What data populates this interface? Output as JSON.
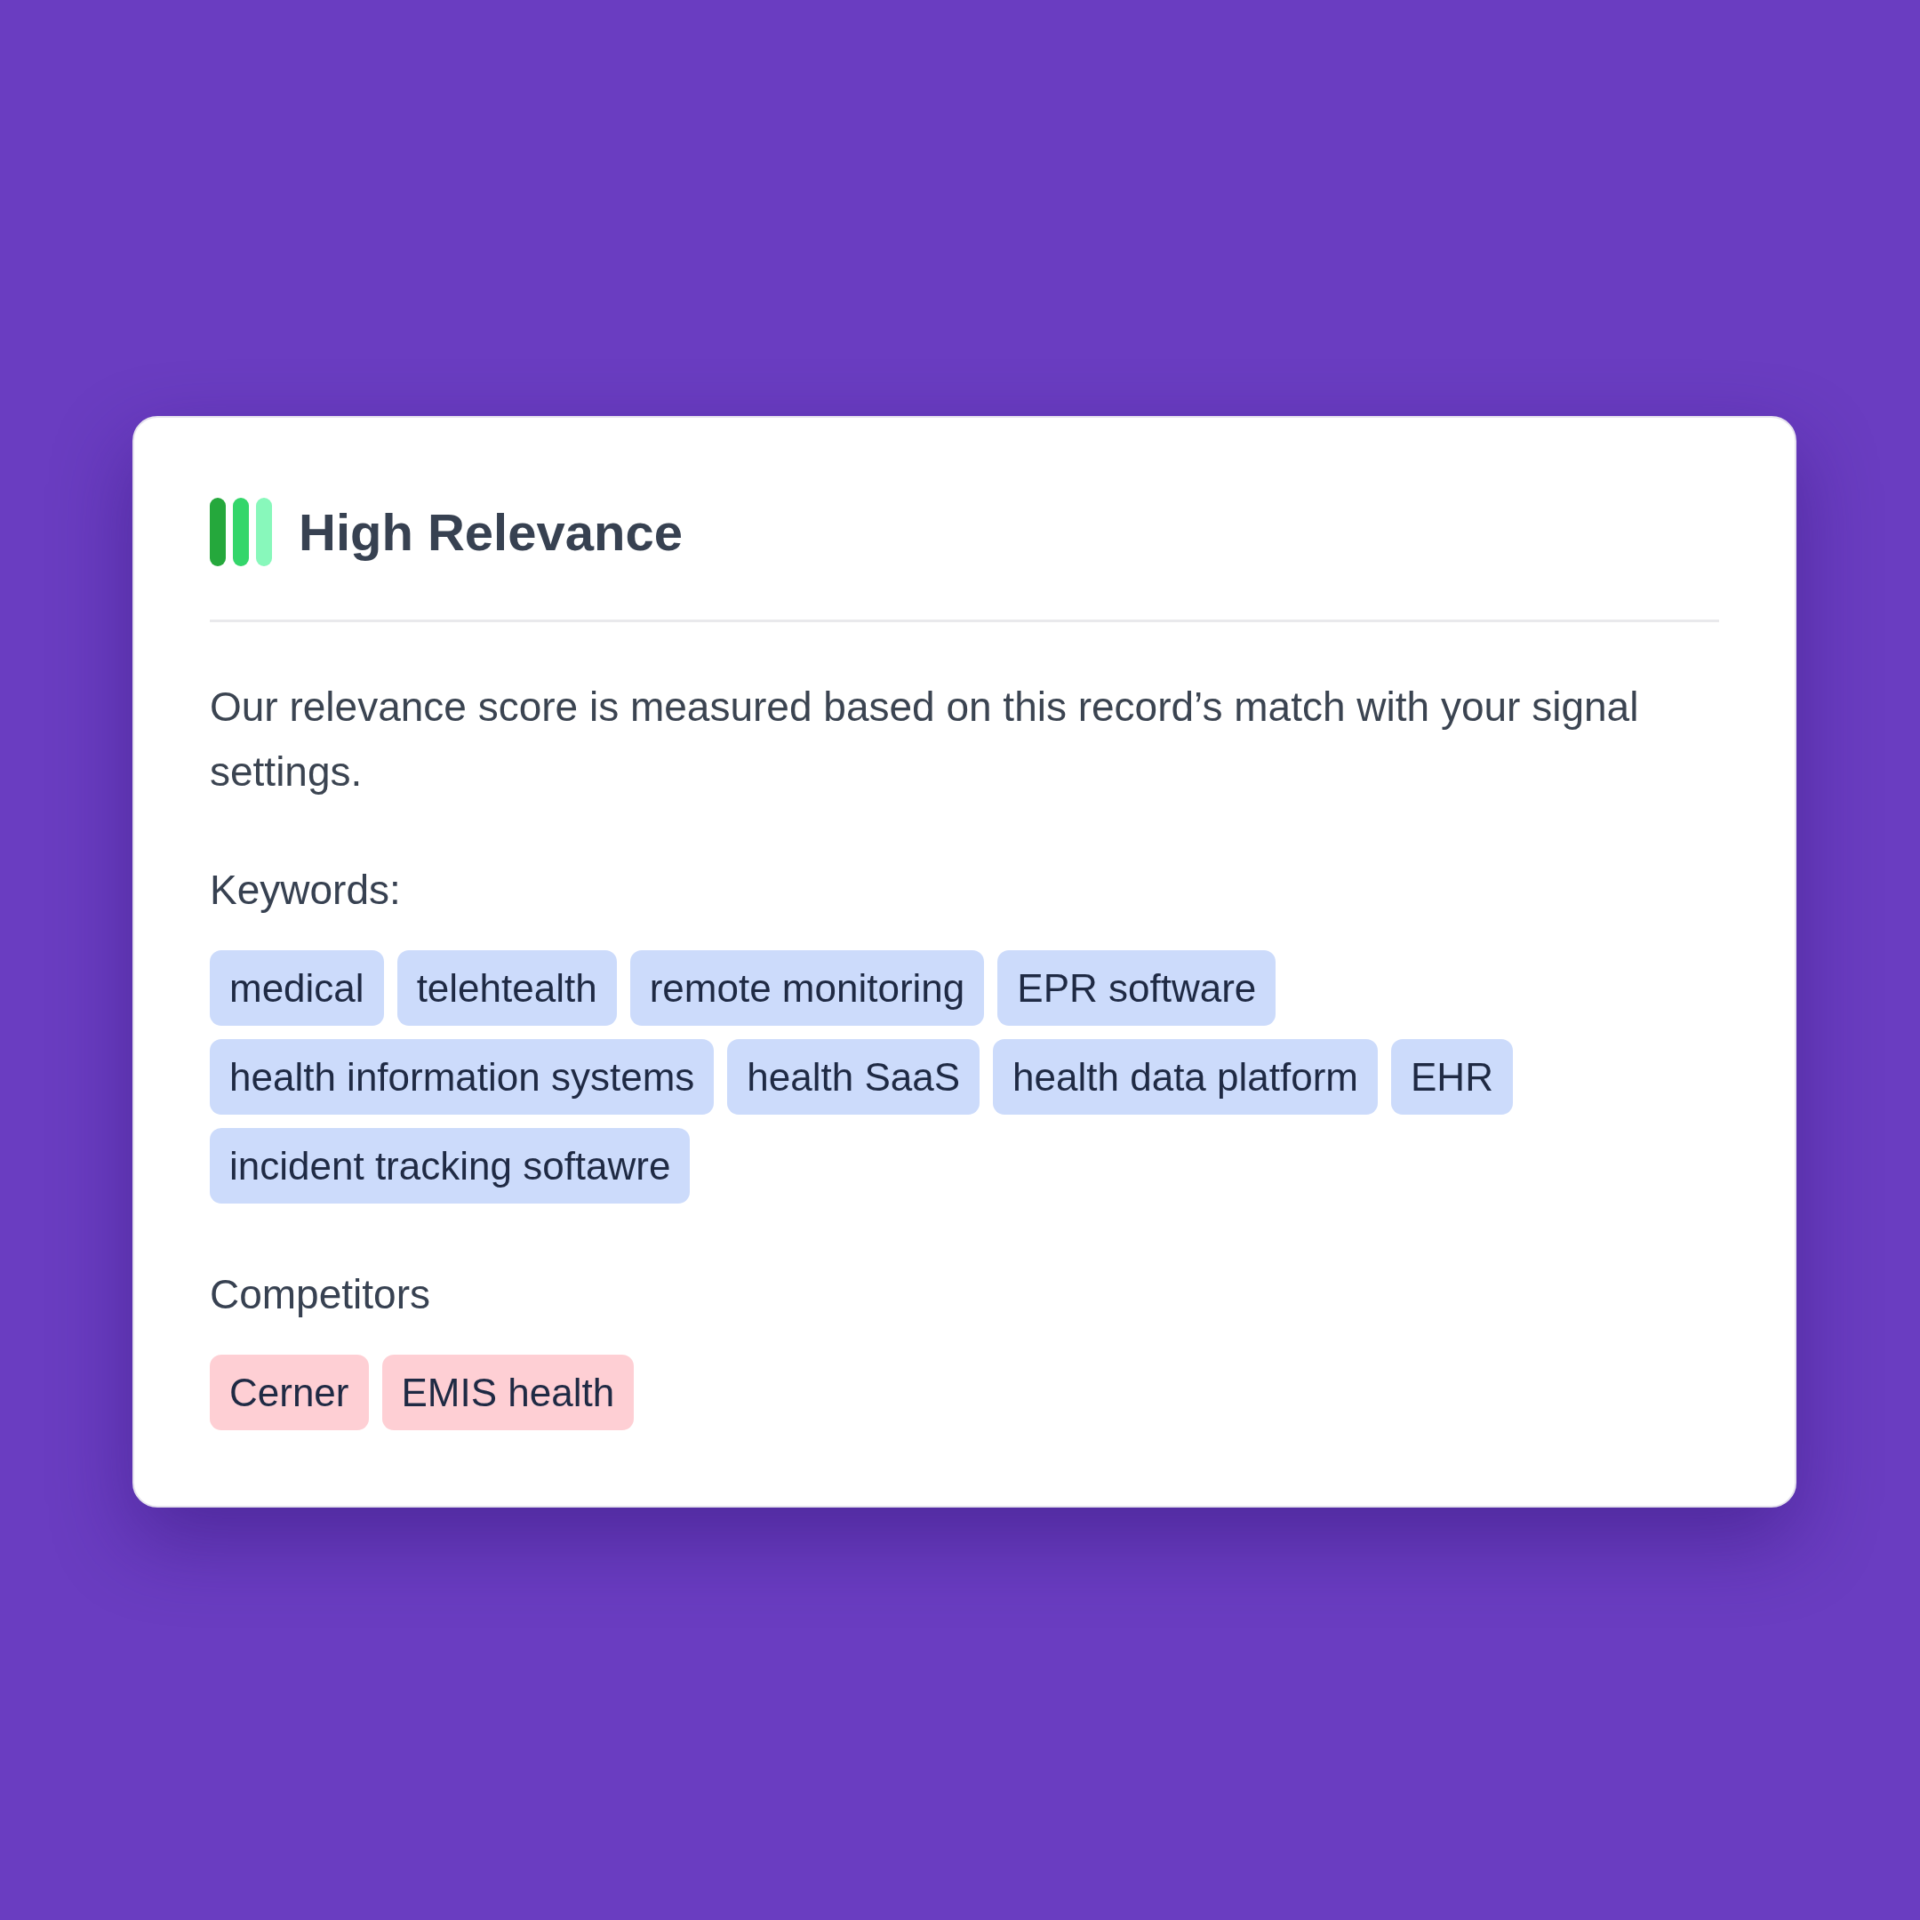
{
  "card": {
    "title": "High Relevance",
    "description": "Our relevance score is measured based on this record’s match with your signal settings.",
    "sections": [
      {
        "heading": "Keywords:",
        "kind": "keyword",
        "tags": [
          "medical",
          "telehtealth",
          "remote monitoring",
          "EPR software",
          "health information systems",
          "health SaaS",
          "health data platform",
          "EHR",
          "incident tracking softawre"
        ]
      },
      {
        "heading": "Competitors",
        "kind": "competitor",
        "tags": [
          "Cerner",
          "EMIS health"
        ]
      }
    ]
  }
}
